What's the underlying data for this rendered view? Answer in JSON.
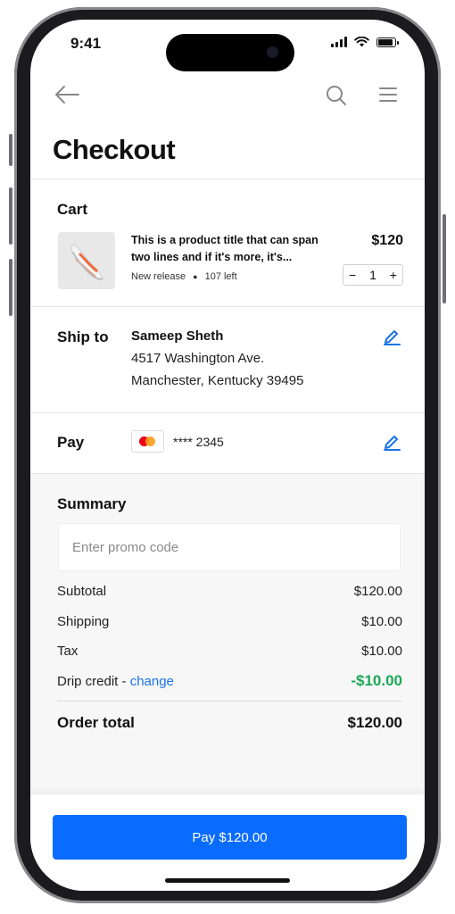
{
  "status_bar": {
    "time": "9:41"
  },
  "page": {
    "title": "Checkout"
  },
  "cart": {
    "label": "Cart",
    "product": {
      "title": "This is a product title that can span two lines and if it's more, it's...",
      "badge": "New release",
      "stock": "107 left",
      "price": "$120",
      "quantity": "1",
      "minus": "−",
      "plus": "+"
    }
  },
  "ship": {
    "label": "Ship to",
    "name": "Sameep Sheth",
    "address_line1": "4517 Washington Ave.",
    "address_line2": "Manchester, Kentucky 39495"
  },
  "pay": {
    "label": "Pay",
    "card_icon": "mastercard-icon",
    "card_number": "**** 2345"
  },
  "summary": {
    "label": "Summary",
    "promo_placeholder": "Enter promo code",
    "rows": [
      {
        "label": "Subtotal",
        "value": "$120.00"
      },
      {
        "label": "Shipping",
        "value": "$10.00"
      },
      {
        "label": "Tax",
        "value": "$10.00"
      }
    ],
    "credit": {
      "label": "Drip credit - ",
      "link": "change",
      "value": "-$10.00"
    },
    "total": {
      "label": "Order total",
      "value": "$120.00"
    }
  },
  "actions": {
    "pay_button": "Pay $120.00"
  },
  "colors": {
    "accent": "#0a6cff",
    "link": "#1a73e8",
    "credit": "#1aa856"
  }
}
